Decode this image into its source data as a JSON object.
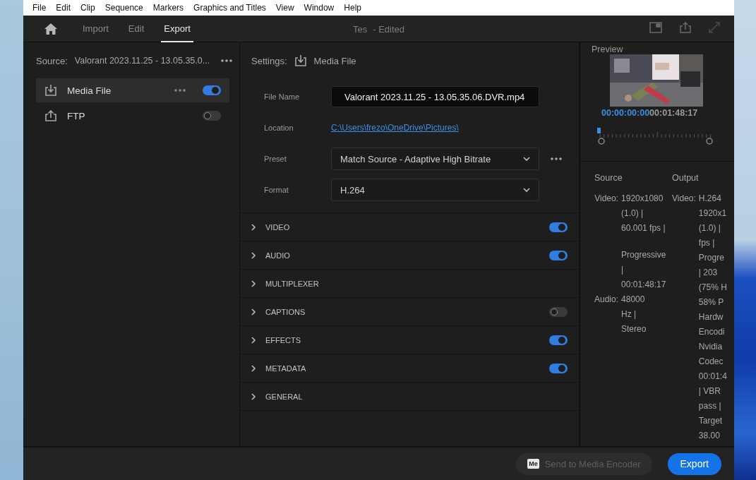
{
  "menu": [
    "File",
    "Edit",
    "Clip",
    "Sequence",
    "Markers",
    "Graphics and Titles",
    "View",
    "Window",
    "Help"
  ],
  "tabs": [
    {
      "label": "Import",
      "selected": false
    },
    {
      "label": "Edit",
      "selected": false
    },
    {
      "label": "Export",
      "selected": true
    }
  ],
  "title": {
    "name": "Tes",
    "status": "- Edited"
  },
  "source": {
    "label": "Source:",
    "value": "Valorant 2023.11.25 - 13.05.35.0..."
  },
  "destinations": [
    {
      "label": "Media File",
      "kind": "download",
      "selected": true,
      "on": true
    },
    {
      "label": "FTP",
      "kind": "upload",
      "selected": false,
      "on": false
    }
  ],
  "settings": {
    "label": "Settings:",
    "value": "Media File"
  },
  "fields": [
    {
      "label": "File Name",
      "kind": "input",
      "value": "Valorant 2023.11.25 - 13.05.35.06.DVR.mp4"
    },
    {
      "label": "Location",
      "kind": "link",
      "value": "C:\\Users\\frezo\\OneDrive\\Pictures\\"
    },
    {
      "label": "Preset",
      "kind": "select",
      "value": "Match Source - Adaptive High Bitrate",
      "more": true
    },
    {
      "label": "Format",
      "kind": "select",
      "value": "H.264",
      "more": false
    }
  ],
  "sections": [
    {
      "label": "VIDEO",
      "expanded": false,
      "on": true
    },
    {
      "label": "AUDIO",
      "expanded": false,
      "on": true
    },
    {
      "label": "MULTIPLEXER",
      "expanded": false
    },
    {
      "label": "CAPTIONS",
      "expanded": false,
      "on": false
    },
    {
      "label": "EFFECTS",
      "expanded": false,
      "on": true
    },
    {
      "label": "METADATA",
      "expanded": false,
      "on": true
    },
    {
      "label": "GENERAL",
      "expanded": false
    }
  ],
  "preview": {
    "title": "Preview",
    "current_time": "00:00:00:00",
    "duration": "00:01:48:17"
  },
  "summary": {
    "source_heading": "Source",
    "output_heading": "Output",
    "source_video_label": "Video:",
    "source_video": [
      "1920x1080",
      "(1.0) |",
      "60.001 fps |"
    ],
    "source_video_scan": [
      "Progressive",
      "|",
      "00:01:48:17"
    ],
    "source_audio_label": "Audio:",
    "source_audio": [
      "48000",
      "Hz |",
      "Stereo"
    ],
    "output_video_label": "Video:",
    "output_video": [
      "H.264",
      "1920x1",
      "(1.0) |",
      "fps |",
      "Progre",
      "| 203",
      "(75% H",
      "58% P",
      "Hardw",
      "Encodi",
      "Nvidia",
      "Codec",
      "00:01:4",
      "| VBR",
      "pass |",
      "Target",
      "38.00"
    ]
  },
  "buttons": {
    "media_encoder": {
      "badge": "Me",
      "label": "Send to Media Encoder",
      "disabled": true
    },
    "export": {
      "label": "Export"
    }
  }
}
